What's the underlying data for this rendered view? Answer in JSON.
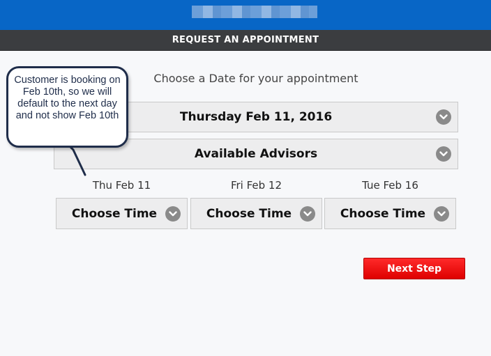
{
  "header": {
    "obscured_title": "",
    "subheader": "REQUEST AN APPOINTMENT"
  },
  "main": {
    "prompt": "Choose a Date for your appointment",
    "date_select": {
      "value": "Thursday Feb 11, 2016"
    },
    "advisor_select": {
      "value": "Available Advisors"
    },
    "days": [
      {
        "label": "Thu Feb 11",
        "time_button": "Choose Time"
      },
      {
        "label": "Fri Feb 12",
        "time_button": "Choose Time"
      },
      {
        "label": "Tue Feb 16",
        "time_button": "Choose Time"
      }
    ],
    "next_button": "Next Step"
  },
  "annotation": {
    "callout_text": "Customer is booking on Feb 10th, so we will default to the next day and not show Feb 10th"
  },
  "icons": {
    "dropdown": "chevron-down-icon"
  },
  "colors": {
    "topbar": "#0866c6",
    "subbar": "#3b3d40",
    "next_button": "#ee0000",
    "callout_border": "#1f2d4a"
  }
}
